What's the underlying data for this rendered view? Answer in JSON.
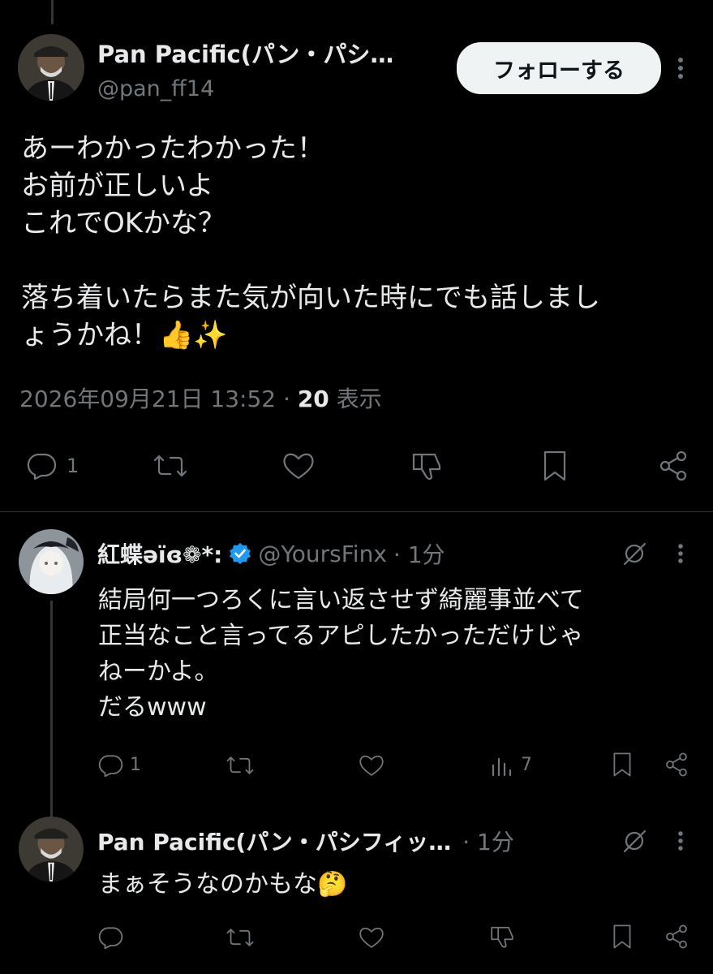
{
  "main_tweet": {
    "display_name": "Pan Pacific(パン・パシ…",
    "handle": "@pan_ff14",
    "follow_label": "フォローする",
    "text": "あーわかったわかった！\nお前が正しいよ\nこれでOKかな？\n\n落ち着いたらまた気が向いた時にでも話しまし\nょうかね！👍✨",
    "timestamp": "2026年09月21日 13:52",
    "separator": "·",
    "views_count": "20",
    "views_label": "表示",
    "actions": {
      "reply_count": "1"
    }
  },
  "reply_1": {
    "display_name": "紅蝶ǝïɞ❁*:",
    "handle": "@YoursFinx",
    "time": "· 1分",
    "text": "結局何一つろくに言い返させず綺麗事並べて\n正当なこと言ってるアピしたかっただけじゃ\nねーかよ。\nだるwww",
    "actions": {
      "reply_count": "1",
      "views_count": "7"
    }
  },
  "reply_2": {
    "display_name": "Pan Pacific(パン・パシフィッ…",
    "time": "· 1分",
    "text": "まぁそうなのかもな🤔"
  },
  "colors": {
    "background": "#000000",
    "text": "#e7e9ea",
    "muted": "#71767b",
    "verified": "#1d9bf0",
    "follow_button": "#eff3f4"
  }
}
